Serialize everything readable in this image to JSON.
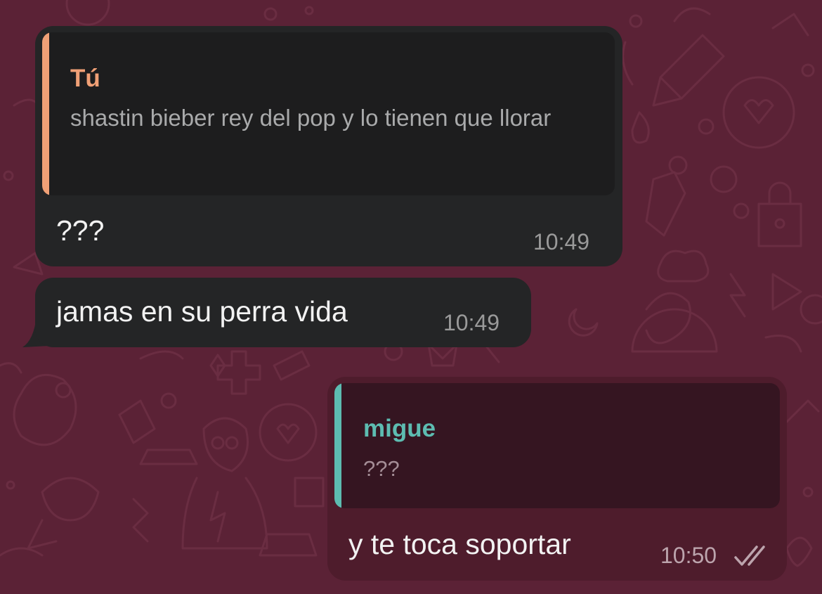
{
  "colors": {
    "background": "#5b2236",
    "incoming_bubble": "#242526",
    "outgoing_bubble": "#4e1c2c",
    "quote_incoming_bg": "#1d1d1e",
    "quote_outgoing_bg": "#351521",
    "quote_bar_tu": "#f0a076",
    "quote_bar_migue": "#5dbcb1",
    "read_ticks": "#bca4ad"
  },
  "messages": [
    {
      "direction": "incoming",
      "quote": {
        "author": "Tú",
        "text": "shastin bieber rey del pop y lo tienen que llorar"
      },
      "text": "???",
      "time": "10:49"
    },
    {
      "direction": "incoming",
      "text": "jamas en su perra vida",
      "time": "10:49"
    },
    {
      "direction": "outgoing",
      "quote": {
        "author": "migue",
        "text": "???"
      },
      "text": "y te toca soportar",
      "time": "10:50",
      "status_icon": "double-check-read-icon"
    }
  ]
}
